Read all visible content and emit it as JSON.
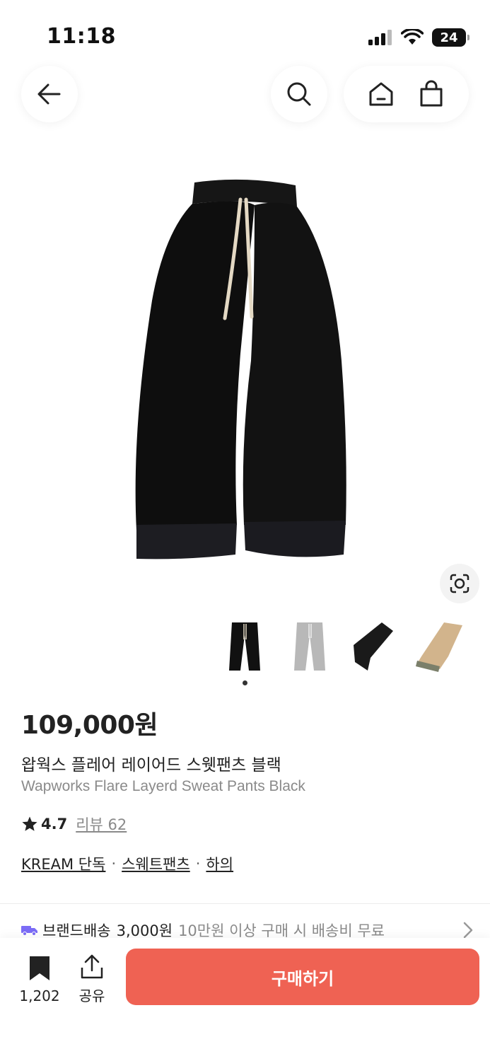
{
  "status_bar": {
    "time": "11:18",
    "battery": "24"
  },
  "nav": {
    "back_icon": "arrow-left-icon",
    "search_icon": "search-icon",
    "home_icon": "home-icon",
    "cart_icon": "shopping-bag-icon"
  },
  "product": {
    "price": "109,000원",
    "name_ko": "왑웍스 플레어 레이어드 스웻팬츠 블랙",
    "name_en": "Wapworks Flare Layerd Sweat Pants Black",
    "rating": "4.7",
    "review_label": "리뷰 62",
    "tags": [
      "KREAM 단독",
      "스웨트팬츠",
      "하의"
    ],
    "thumbnail_colors": [
      "#111111",
      "#b8b8b8",
      "#1a1a1a",
      "#d2b48c"
    ]
  },
  "delivery": {
    "label": "브랜드배송",
    "price": "3,000원",
    "note": "10만원 이상 구매 시 배송비 무료"
  },
  "bottom_bar": {
    "bookmark_count": "1,202",
    "share_label": "공유",
    "buy_label": "구매하기",
    "accent_color": "#ef6253"
  }
}
